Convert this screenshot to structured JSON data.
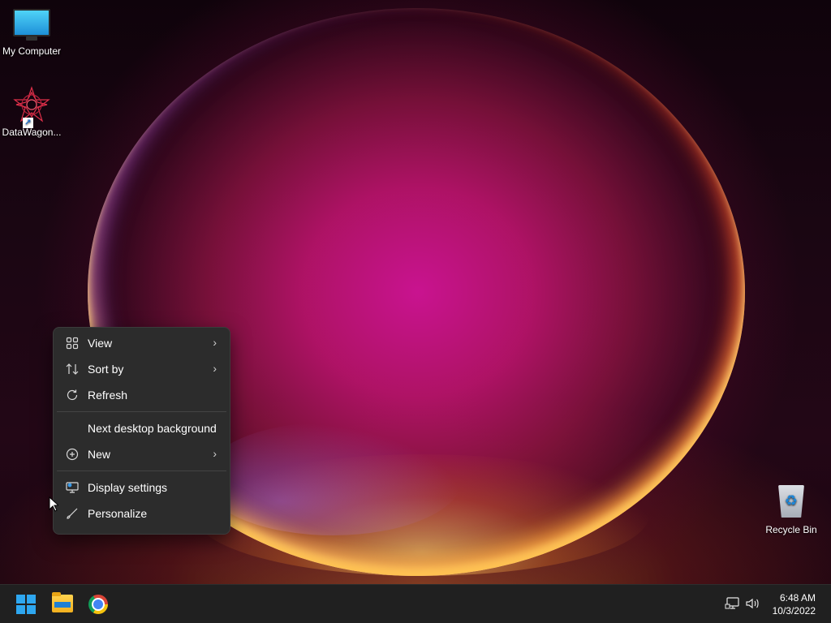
{
  "desktop": {
    "icons": [
      {
        "label": "My Computer",
        "icon": "monitor-icon"
      },
      {
        "label": "DataWagon...",
        "icon": "star-logo-icon"
      },
      {
        "label": "Recycle Bin",
        "icon": "recycle-bin-icon"
      }
    ]
  },
  "context_menu": {
    "items": [
      {
        "label": "View",
        "icon": "grid-icon",
        "submenu": true
      },
      {
        "label": "Sort by",
        "icon": "sort-icon",
        "submenu": true
      },
      {
        "label": "Refresh",
        "icon": "refresh-icon",
        "submenu": false
      },
      {
        "label": "Next desktop background",
        "icon": "",
        "submenu": false
      },
      {
        "label": "New",
        "icon": "plus-circle-icon",
        "submenu": true
      },
      {
        "label": "Display settings",
        "icon": "display-icon",
        "submenu": false
      },
      {
        "label": "Personalize",
        "icon": "brush-icon",
        "submenu": false
      }
    ],
    "chevron": "›"
  },
  "taskbar": {
    "apps": [
      {
        "name": "start",
        "icon": "windows-logo-icon"
      },
      {
        "name": "file-explorer",
        "icon": "folder-icon"
      },
      {
        "name": "chrome",
        "icon": "chrome-icon"
      }
    ],
    "tray": {
      "network_icon": "network-icon",
      "volume_icon": "volume-icon"
    },
    "clock": {
      "time": "6:48 AM",
      "date": "10/3/2022"
    }
  },
  "colors": {
    "accent": "#2ea7f0",
    "menu_bg": "#2c2c2c",
    "taskbar_bg": "#202020"
  }
}
